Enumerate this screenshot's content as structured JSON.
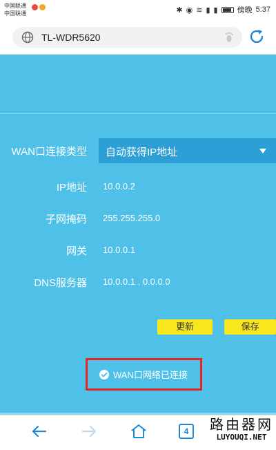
{
  "status_bar": {
    "carrier_1": "中国联通",
    "carrier_2": "中国联通",
    "time": "5:37",
    "time_prefix": "傍晚"
  },
  "browser": {
    "url": "TL-WDR5620"
  },
  "wan_form": {
    "connection_type_label": "WAN口连接类型",
    "connection_type_value": "自动获得IP地址",
    "ip_label": "IP地址",
    "ip_value": "10.0.0.2",
    "mask_label": "子网掩码",
    "mask_value": "255.255.255.0",
    "gateway_label": "网关",
    "gateway_value": "10.0.0.1",
    "dns_label": "DNS服务器",
    "dns_value": "10.0.0.1 , 0.0.0.0"
  },
  "actions": {
    "refresh_label": "更新",
    "save_label": "保存"
  },
  "status": {
    "text": "WAN口网络已连接",
    "color": "#e52521"
  },
  "toolbar": {
    "tab_count": "4"
  },
  "watermark": {
    "cn": "路由器网",
    "en": "LUYOUQI.NET"
  },
  "colors": {
    "background": "#4fc0e8",
    "select_bg": "#2d9fd7",
    "button_bg": "#f8e71c",
    "accent": "#1e88d8"
  }
}
